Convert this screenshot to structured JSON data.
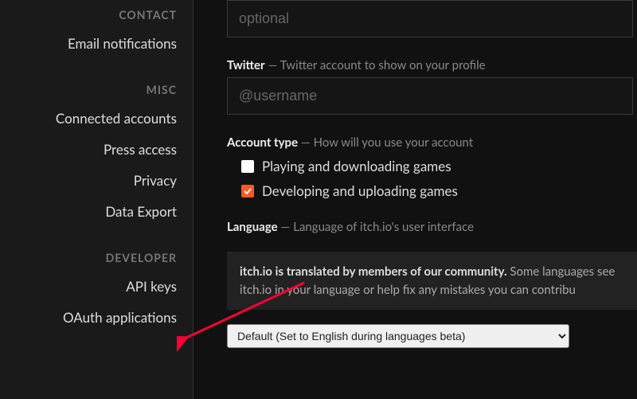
{
  "sidebar": {
    "sections": [
      {
        "header": "CONTACT",
        "items": [
          {
            "label": "Email notifications",
            "name": "sidebar-item-email-notifications"
          }
        ]
      },
      {
        "header": "MISC",
        "items": [
          {
            "label": "Connected accounts",
            "name": "sidebar-item-connected-accounts"
          },
          {
            "label": "Press access",
            "name": "sidebar-item-press-access"
          },
          {
            "label": "Privacy",
            "name": "sidebar-item-privacy"
          },
          {
            "label": "Data Export",
            "name": "sidebar-item-data-export"
          }
        ]
      },
      {
        "header": "DEVELOPER",
        "items": [
          {
            "label": "API keys",
            "name": "sidebar-item-api-keys"
          },
          {
            "label": "OAuth applications",
            "name": "sidebar-item-oauth-applications"
          }
        ]
      }
    ]
  },
  "main": {
    "website": {
      "placeholder": "optional"
    },
    "twitter": {
      "label": "Twitter",
      "hint": " — Twitter account to show on your profile",
      "placeholder": "@username"
    },
    "account_type": {
      "label": "Account type",
      "hint": " — How will you use your account",
      "options": [
        {
          "label": "Playing and downloading games",
          "checked": false
        },
        {
          "label": "Developing and uploading games",
          "checked": true
        }
      ]
    },
    "language": {
      "label": "Language",
      "hint": " — Language of itch.io's user interface",
      "note_bold": "itch.io is translated by members of our community.",
      "note_rest": " Some languages see itch.io in your language or help fix any mistakes you can contribu",
      "select_value": "Default (Set to English during languages beta)"
    }
  },
  "colors": {
    "accent": "#ff5722"
  }
}
